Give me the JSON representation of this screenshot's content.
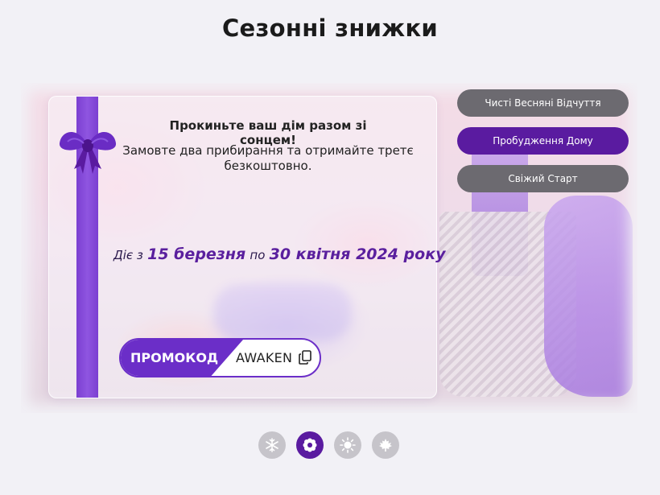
{
  "page": {
    "title": "Сезонні знижки"
  },
  "offer": {
    "headline": "Прокиньте ваш дім разом зі сонцем!",
    "subtext": "Замовте два прибирання та отримайте третє безкоштовно.",
    "validity": {
      "prefix": "Діє з",
      "start": "15 березня",
      "middle": "по",
      "end": "30 квітня 2024 року"
    },
    "promo": {
      "label": "ПРОМОКОД",
      "code": "AWAKEN"
    }
  },
  "tabs": [
    {
      "label": "Чисті Весняні Відчуття",
      "active": false
    },
    {
      "label": "Пробудження Дому",
      "active": true
    },
    {
      "label": "Свіжий Старт",
      "active": false
    }
  ],
  "season_dots": [
    {
      "icon": "snowflake-icon",
      "active": false
    },
    {
      "icon": "flower-icon",
      "active": true
    },
    {
      "icon": "sun-icon",
      "active": false
    },
    {
      "icon": "maple-leaf-icon",
      "active": false
    }
  ],
  "colors": {
    "accent": "#5a1ba0",
    "ribbon": "#7b3fd1",
    "tab_inactive": "#6c6a70",
    "dot_inactive": "#c6c4ca"
  }
}
